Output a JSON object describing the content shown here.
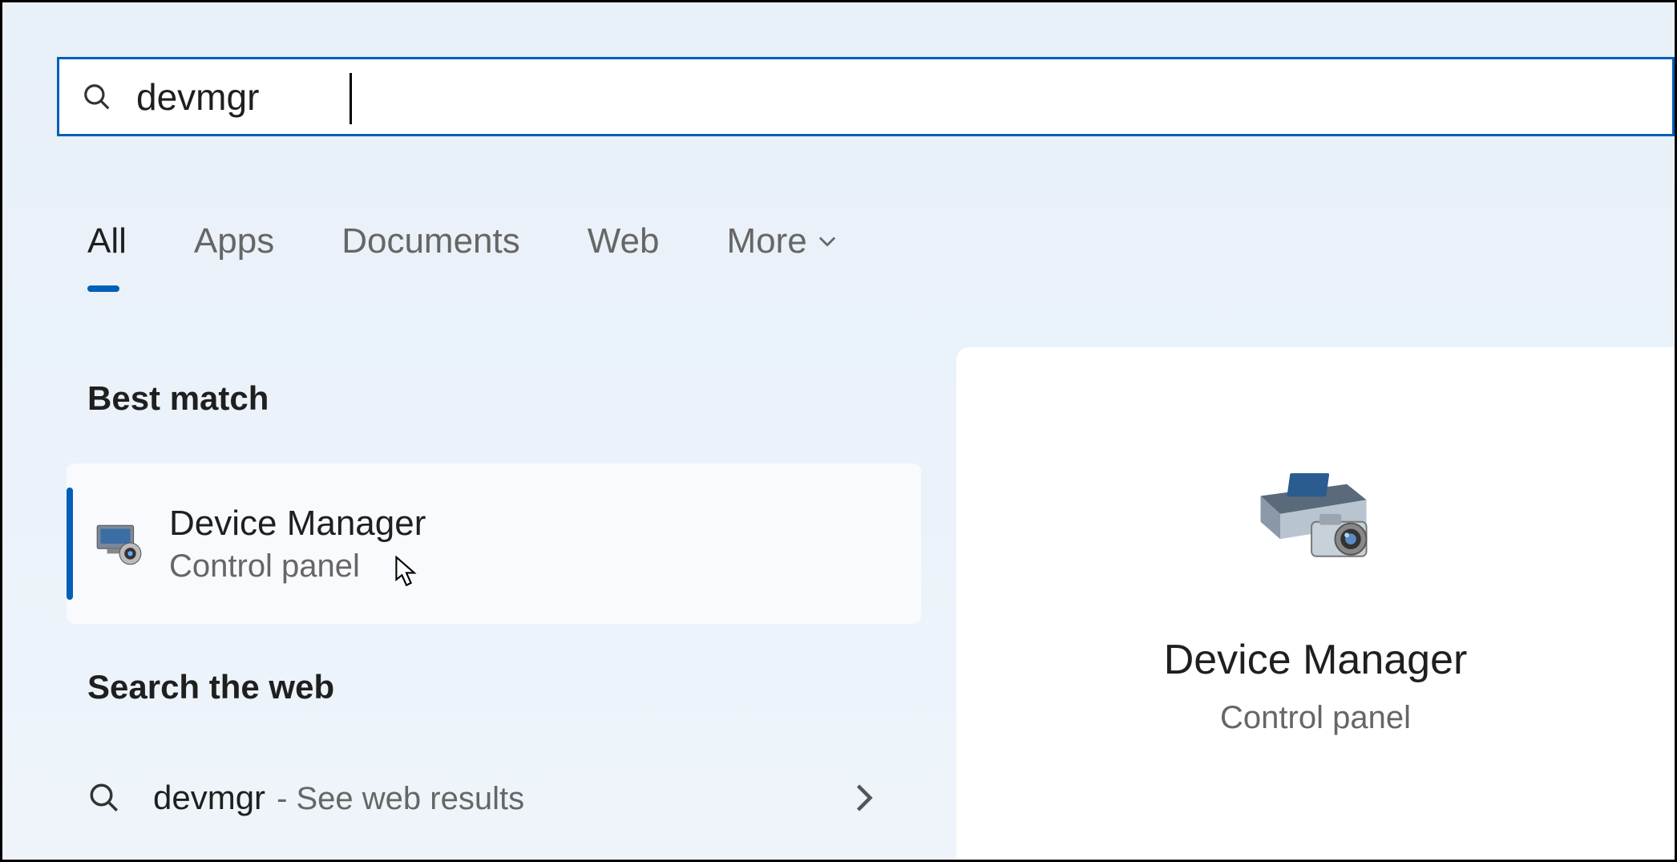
{
  "search": {
    "query": "devmgr"
  },
  "tabs": {
    "all": "All",
    "apps": "Apps",
    "documents": "Documents",
    "web": "Web",
    "more": "More"
  },
  "sections": {
    "best_match": "Best match",
    "search_web": "Search the web"
  },
  "best_match_result": {
    "title": "Device Manager",
    "subtitle": "Control panel"
  },
  "web_results": [
    {
      "query": "devmgr",
      "suffix": "- See web results"
    }
  ],
  "detail": {
    "title": "Device Manager",
    "subtitle": "Control panel"
  }
}
